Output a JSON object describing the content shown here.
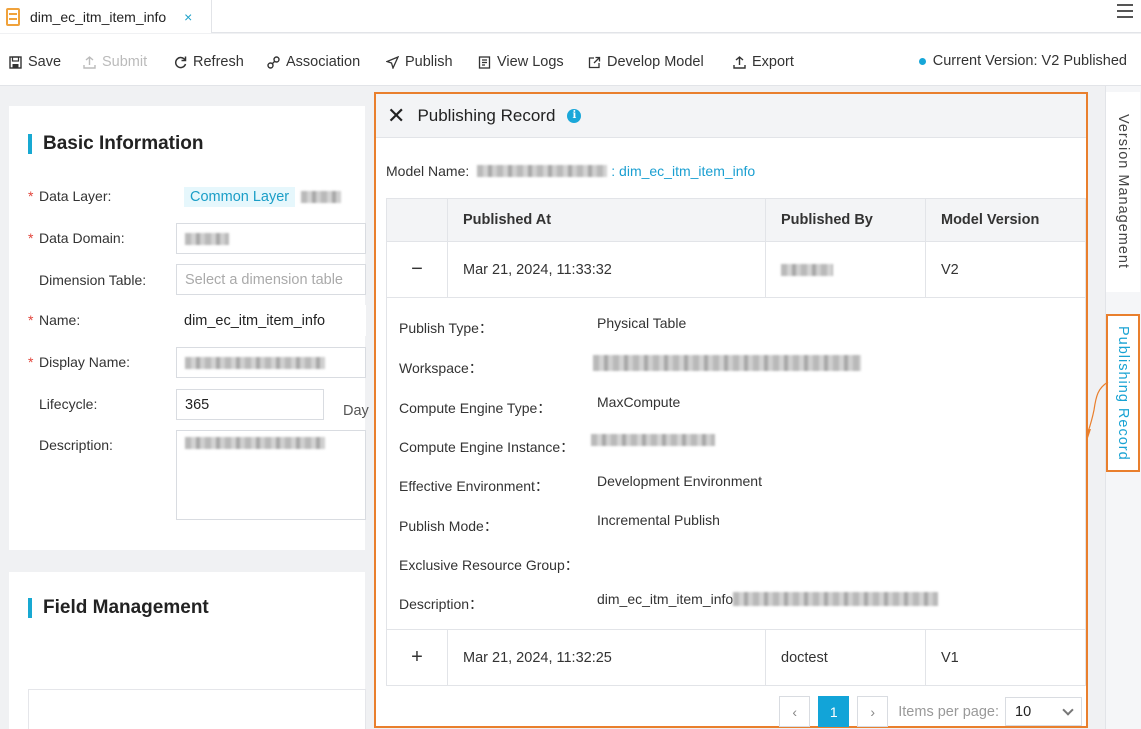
{
  "tab": {
    "title": "dim_ec_itm_item_info",
    "close": "×"
  },
  "toolbar": {
    "save": "Save",
    "submit": "Submit",
    "refresh": "Refresh",
    "association": "Association",
    "publish": "Publish",
    "view_logs": "View Logs",
    "develop_model": "Develop Model",
    "export": "Export",
    "current_version": "Current Version: V2 Published"
  },
  "basic_info": {
    "title": "Basic Information",
    "data_layer_label": "Data Layer:",
    "data_layer_tag": "Common Layer",
    "data_domain_label": "Data Domain:",
    "dimension_table_label": "Dimension Table:",
    "dimension_table_placeholder": "Select a dimension table",
    "name_label": "Name:",
    "name_value": "dim_ec_itm_item_info",
    "display_name_label": "Display Name:",
    "lifecycle_label": "Lifecycle:",
    "lifecycle_value": "365",
    "lifecycle_unit": "Day",
    "description_label": "Description:",
    "required_mark": "*"
  },
  "field_mgmt": {
    "title": "Field Management"
  },
  "side_tabs": {
    "version_management": "Version Management",
    "publishing_record": "Publishing Record"
  },
  "drawer": {
    "title": "Publishing Record",
    "info_icon": "i",
    "close": "✕",
    "model_name_label": "Model Name:",
    "model_name_link": ": dim_ec_itm_item_info",
    "columns": {
      "published_at": "Published At",
      "published_by": "Published By",
      "model_version": "Model Version"
    },
    "rows": [
      {
        "toggle": "−",
        "published_at": "Mar 21, 2024, 11:33:32",
        "published_by": "",
        "model_version": "V2"
      },
      {
        "toggle": "+",
        "published_at": "Mar 21, 2024, 11:32:25",
        "published_by": "doctest",
        "model_version": "V1"
      }
    ],
    "detail": {
      "publish_type_label": "Publish Type：",
      "publish_type": "Physical Table",
      "workspace_label": "Workspace：",
      "compute_engine_type_label": "Compute Engine Type：",
      "compute_engine_type": "MaxCompute",
      "compute_engine_instance_label": "Compute Engine Instance：",
      "effective_env_label": "Effective Environment：",
      "effective_env": "Development Environment",
      "publish_mode_label": "Publish Mode：",
      "publish_mode": "Incremental Publish",
      "exclusive_rg_label": "Exclusive Resource Group：",
      "description_label": "Description：",
      "description": "dim_ec_itm_item_info"
    },
    "pagination": {
      "prev": "‹",
      "current": "1",
      "next": "›",
      "items_per_page_label": "Items per page:",
      "items_per_page": "10"
    }
  },
  "colors": {
    "accent": "#12a4d8",
    "highlight": "#e97f2d",
    "tag_bg": "#e6f7fc"
  }
}
